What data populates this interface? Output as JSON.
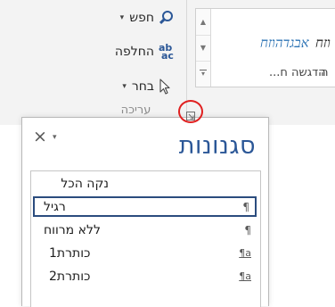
{
  "ribbon": {
    "editing_group": {
      "label": "עריכה",
      "find_label": "חפש",
      "replace_label": "החלפה",
      "select_label": "בחר",
      "replace_icon_top": "ab",
      "replace_icon_bottom": "ac",
      "dropdown_glyph": "▾"
    },
    "styles_gallery": {
      "samples": [
        {
          "sample_text": "אבגדהוזח",
          "name": "הדגשה ח..."
        },
        {
          "sample_text": "וזח",
          "name": "ה"
        }
      ],
      "scroll_up": "▲",
      "scroll_down": "▼",
      "more_glyph": "▾"
    },
    "dialog_launcher_icon": "dialog-launcher-icon",
    "highlight_color": "#e02020"
  },
  "styles_pane": {
    "title": "סגנונות",
    "close_glyph": "×",
    "menu_glyph": "▾",
    "items": [
      {
        "name": "נקה הכל",
        "mark": "",
        "selected": false
      },
      {
        "name": "רגיל",
        "mark": "¶",
        "selected": true
      },
      {
        "name": "ללא מרווח",
        "mark": "¶",
        "selected": false
      },
      {
        "name": "כותרת1",
        "mark": "¶a",
        "selected": false
      },
      {
        "name": "כותרת2",
        "mark": "¶a",
        "selected": false
      }
    ],
    "accent_color": "#2b5797"
  }
}
